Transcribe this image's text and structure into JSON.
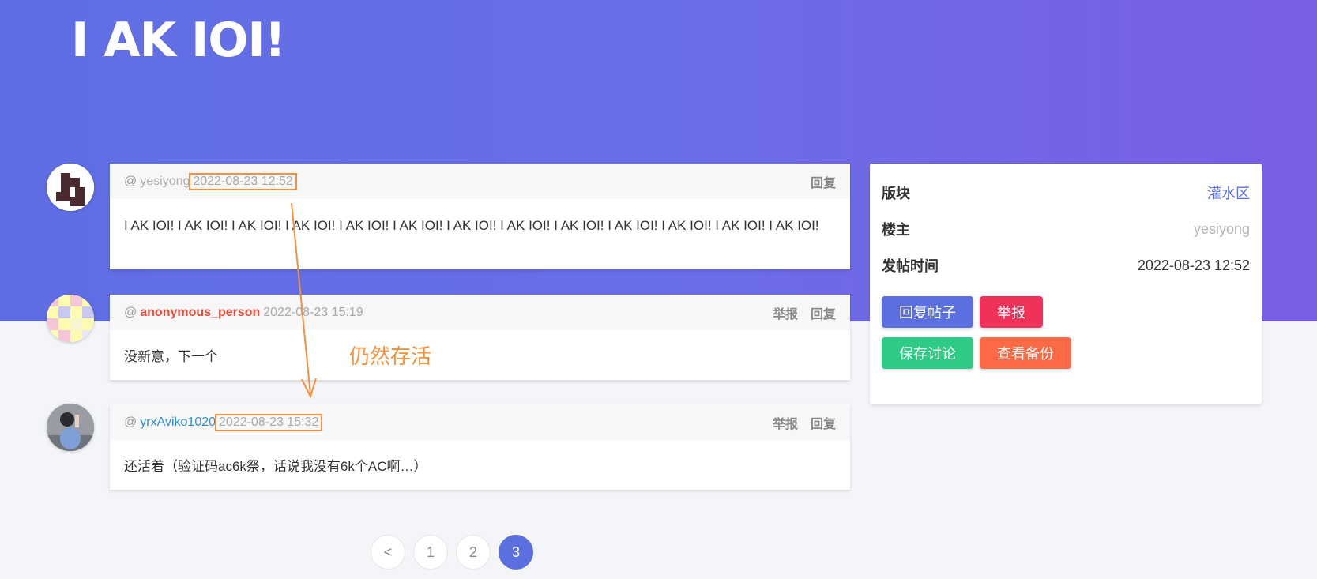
{
  "page": {
    "title": "I AK IOI!"
  },
  "posts": [
    {
      "at": "@",
      "user": "yesiyong",
      "time": "2022-08-23 12:52",
      "actions": [
        "回复"
      ],
      "content": "I AK IOI! I AK IOI! I AK IOI! I AK IOI! I AK IOI! I AK IOI! I AK IOI! I AK IOI! I AK IOI! I AK IOI! I AK IOI! I AK IOI! I AK IOI!"
    },
    {
      "at": "@",
      "user": "anonymous_person",
      "time": "2022-08-23 15:19",
      "actions": [
        "举报",
        "回复"
      ],
      "content": "没新意，下一个"
    },
    {
      "at": "@",
      "user": "yrxAviko1020",
      "time": "2022-08-23 15:32",
      "actions": [
        "举报",
        "回复"
      ],
      "content": "还活着（验证码ac6k祭，话说我没有6k个AC啊…）"
    }
  ],
  "side": {
    "rows": [
      {
        "label": "版块",
        "value": "灌水区"
      },
      {
        "label": "楼主",
        "value": "yesiyong"
      },
      {
        "label": "发帖时间",
        "value": "2022-08-23 12:52"
      }
    ],
    "buttons": {
      "reply": "回复帖子",
      "report": "举报",
      "save": "保存讨论",
      "backup": "查看备份"
    }
  },
  "pagination": {
    "prev": "<",
    "pages": [
      "1",
      "2",
      "3"
    ],
    "current": "3"
  },
  "annotation": {
    "text": "仍然存活",
    "color": "#f5913e"
  },
  "colors": {
    "accent": "#5b6fdf",
    "report": "#f0325a",
    "save": "#2ecb86",
    "backup": "#fb6a44",
    "user_red": "#e74c3c",
    "user_blue": "#2f8fd0"
  }
}
